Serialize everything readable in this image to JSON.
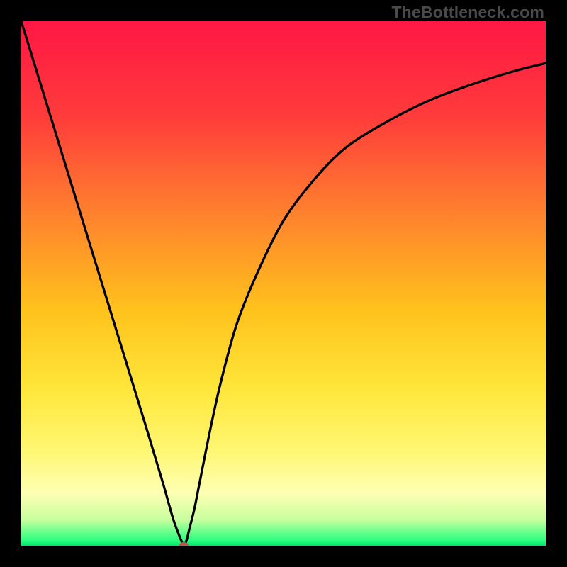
{
  "watermark": "TheBottleneck.com",
  "chart_data": {
    "type": "line",
    "title": "",
    "xlabel": "",
    "ylabel": "",
    "xlim": [
      0,
      100
    ],
    "ylim": [
      0,
      100
    ],
    "grid": false,
    "gradient_stops": [
      {
        "offset": 0,
        "color": "#ff1744"
      },
      {
        "offset": 18,
        "color": "#ff3b3b"
      },
      {
        "offset": 35,
        "color": "#ff7b2f"
      },
      {
        "offset": 55,
        "color": "#ffc21c"
      },
      {
        "offset": 70,
        "color": "#ffe63a"
      },
      {
        "offset": 82,
        "color": "#fff773"
      },
      {
        "offset": 90,
        "color": "#fdffb3"
      },
      {
        "offset": 95,
        "color": "#c8ff9e"
      },
      {
        "offset": 99,
        "color": "#2aff80"
      },
      {
        "offset": 100,
        "color": "#00e46b"
      }
    ],
    "series": [
      {
        "name": "bottleneck-curve",
        "color": "#000000",
        "x": [
          0,
          4,
          8,
          12,
          16,
          20,
          24,
          27,
          29,
          30.5,
          31,
          31.5,
          32,
          33,
          34,
          36,
          38,
          41,
          45,
          50,
          56,
          62,
          70,
          78,
          86,
          94,
          100
        ],
        "y": [
          100,
          87,
          74,
          61,
          48,
          35,
          22,
          12,
          5,
          1,
          0,
          1,
          3,
          7,
          12,
          22,
          31,
          42,
          52,
          62,
          70,
          76,
          81,
          85,
          88,
          90.5,
          92
        ]
      }
    ],
    "marker": {
      "name": "optimal-point",
      "x": 31,
      "y": 0,
      "color": "#c0524f",
      "rx": 0.9,
      "ry": 0.7
    }
  }
}
